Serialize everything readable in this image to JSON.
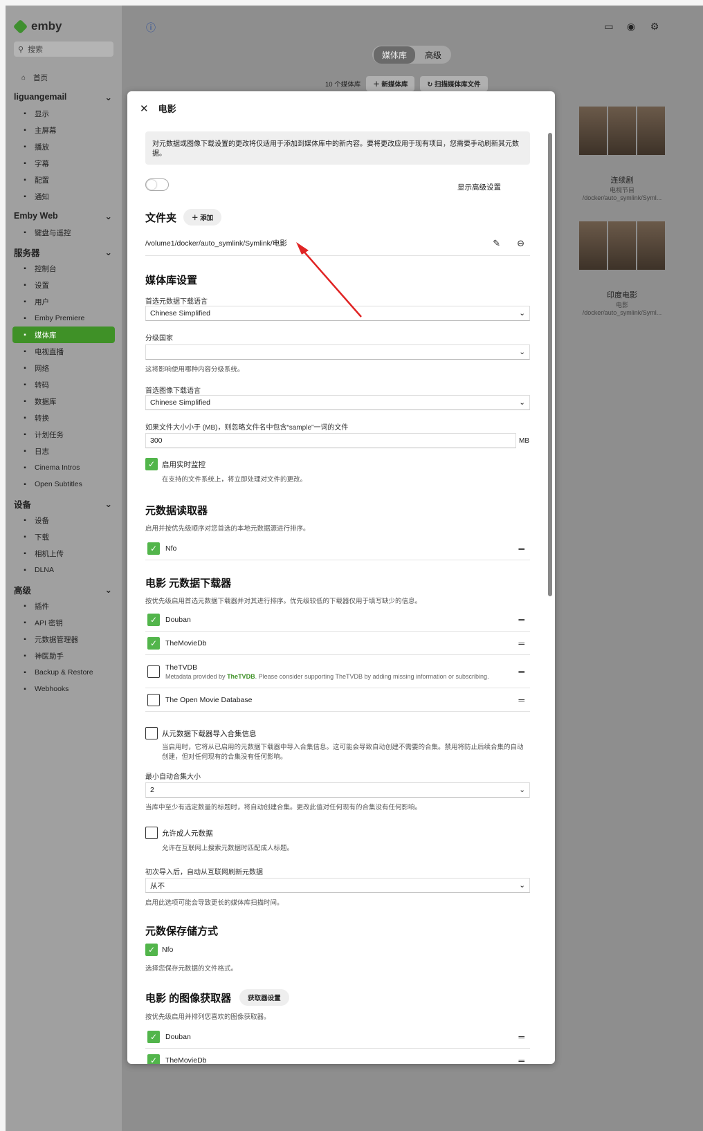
{
  "app": {
    "brand": "emby",
    "search_placeholder": "搜索"
  },
  "nav": {
    "home": "首页",
    "sections": [
      {
        "title": "liguangemail",
        "items": [
          {
            "icon": "display-icon",
            "label": "显示"
          },
          {
            "icon": "home-icon",
            "label": "主屏幕"
          },
          {
            "icon": "play-icon",
            "label": "播放"
          },
          {
            "icon": "subtitle-icon",
            "label": "字幕"
          },
          {
            "icon": "profile-icon",
            "label": "配置"
          },
          {
            "icon": "bell-icon",
            "label": "通知"
          }
        ]
      },
      {
        "title": "Emby Web",
        "items": [
          {
            "icon": "keyboard-icon",
            "label": "键盘与遥控"
          }
        ]
      },
      {
        "title": "服务器",
        "items": [
          {
            "icon": "dashboard-icon",
            "label": "控制台"
          },
          {
            "icon": "gear-icon",
            "label": "设置"
          },
          {
            "icon": "users-icon",
            "label": "用户"
          },
          {
            "icon": "star-icon",
            "label": "Emby Premiere"
          },
          {
            "icon": "folder-icon",
            "label": "媒体库",
            "active": true
          },
          {
            "icon": "tv-icon",
            "label": "电视直播"
          },
          {
            "icon": "wifi-icon",
            "label": "网络"
          },
          {
            "icon": "transcode-icon",
            "label": "转码"
          },
          {
            "icon": "database-icon",
            "label": "数据库"
          },
          {
            "icon": "convert-icon",
            "label": "转换"
          },
          {
            "icon": "clock-icon",
            "label": "计划任务"
          },
          {
            "icon": "log-icon",
            "label": "日志"
          },
          {
            "icon": "film-icon",
            "label": "Cinema Intros"
          },
          {
            "icon": "subtitles-icon",
            "label": "Open Subtitles"
          }
        ]
      },
      {
        "title": "设备",
        "items": [
          {
            "icon": "devices-icon",
            "label": "设备"
          },
          {
            "icon": "download-icon",
            "label": "下载"
          },
          {
            "icon": "camera-icon",
            "label": "相机上传"
          },
          {
            "icon": "dlna-icon",
            "label": "DLNA"
          }
        ]
      },
      {
        "title": "高级",
        "items": [
          {
            "icon": "plugin-icon",
            "label": "插件"
          },
          {
            "icon": "key-icon",
            "label": "API 密钥"
          },
          {
            "icon": "edit-icon",
            "label": "元数据管理器"
          },
          {
            "icon": "wizard-icon",
            "label": "神医助手"
          },
          {
            "icon": "restore-icon",
            "label": "Backup & Restore"
          },
          {
            "icon": "webhook-icon",
            "label": "Webhooks"
          }
        ]
      }
    ]
  },
  "top": {
    "tabs": [
      "媒体库",
      "高级"
    ],
    "lib_count": "10 个媒体库",
    "new_lib": "新媒体库",
    "scan": "扫描媒体库文件"
  },
  "cards": [
    {
      "title": "连续剧",
      "sub": "电视节目",
      "path": "/docker/auto_symlink/Syml..."
    },
    {
      "title": "印度电影",
      "sub": "电影",
      "path": "/docker/auto_symlink/Syml..."
    }
  ],
  "modal": {
    "title": "电影",
    "info": "对元数据或图像下载设置的更改将仅适用于添加到媒体库中的新内容。要将更改应用于现有项目，您需要手动刷新其元数据。",
    "advanced_toggle": "显示高级设置",
    "folders_title": "文件夹",
    "add_label": "添加",
    "folder_path": "/volume1/docker/auto_symlink/Symlink/电影",
    "lib_settings": "媒体库设置",
    "meta_lang_label": "首选元数据下载语言",
    "meta_lang": "Chinese Simplified",
    "country_label": "分级国家",
    "country": "",
    "country_hint": "这将影响使用哪种内容分级系统。",
    "img_lang_label": "首选图像下载语言",
    "img_lang": "Chinese Simplified",
    "sample_label": "如果文件大小小于 (MB)，则忽略文件名中包含“sample”一词的文件",
    "sample_value": "300",
    "sample_unit": "MB",
    "realtime_label": "启用实时监控",
    "realtime_hint": "在支持的文件系统上，将立即处理对文件的更改。",
    "readers_title": "元数据读取器",
    "readers_hint": "启用并按优先级顺序对您首选的本地元数据源进行排序。",
    "readers": [
      {
        "name": "Nfo",
        "on": true
      }
    ],
    "downloaders_title": "电影 元数据下载器",
    "downloaders_hint": "按优先级启用首选元数据下载器并对其进行排序。优先级较低的下载器仅用于填写缺少的信息。",
    "downloaders": [
      {
        "name": "Douban",
        "on": true
      },
      {
        "name": "TheMovieDb",
        "on": true
      },
      {
        "name": "TheTVDB",
        "on": false,
        "note_prefix": "Metadata provided by ",
        "note_link": "TheTVDB",
        "note_suffix": ". Please consider supporting TheTVDB by adding missing information or subscribing."
      },
      {
        "name": "The Open Movie Database",
        "on": false
      }
    ],
    "collections_label": "从元数据下载器导入合集信息",
    "collections_hint": "当启用时，它将从已启用的元数据下载器中导入合集信息。这可能会导致自动创建不需要的合集。禁用将防止后续合集的自动创建，但对任何现有的合集没有任何影响。",
    "min_coll_label": "最小自动合集大小",
    "min_coll": "2",
    "min_coll_hint": "当库中至少有选定数量的标题时，将自动创建合集。更改此值对任何现有的合集没有任何影响。",
    "adult_label": "允许成人元数据",
    "adult_hint": "允许在互联网上搜索元数据时匹配成人标题。",
    "refresh_label": "初次导入后，自动从互联网刷新元数据",
    "refresh": "从不",
    "refresh_hint": "启用此选项可能会导致更长的媒体库扫描时间。",
    "savers_title": "元数保存储方式",
    "savers": [
      {
        "name": "Nfo",
        "on": true
      }
    ],
    "savers_hint": "选择您保存元数据的文件格式。",
    "img_fetch_title": "电影 的图像获取器",
    "img_fetch_btn": "获取器设置",
    "img_fetch_hint": "按优先级启用并排列您喜欢的图像获取器。",
    "img_fetchers": [
      {
        "name": "Douban",
        "on": true
      },
      {
        "name": "TheMovieDb",
        "on": true
      }
    ]
  },
  "colors": {
    "accent": "#52b54b",
    "active_nav": "#3f9127",
    "arrow": "#e02424"
  }
}
